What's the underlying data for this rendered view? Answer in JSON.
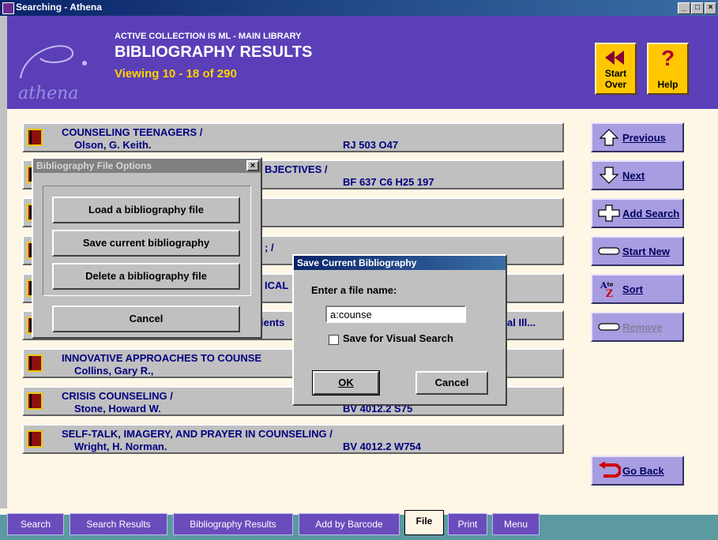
{
  "window": {
    "title": "Searching - Athena",
    "min": "_",
    "max": "□",
    "close": "×"
  },
  "header": {
    "collection": "ACTIVE COLLECTION IS ML - MAIN LIBRARY",
    "title": "BIBLIOGRAPHY RESULTS",
    "viewing": "Viewing 10 - 18 of 290",
    "logo": "athena",
    "start_over": "Start Over",
    "help": "Help"
  },
  "results": [
    {
      "title": "COUNSELING TEENAGERS /",
      "author": "Olson, G. Keith.",
      "call": "RJ 503 O47"
    },
    {
      "title": "BJECTIVES /",
      "author": "",
      "call": "BF 637 C6 H25 197"
    },
    {
      "title": "",
      "author": "",
      "call": ""
    },
    {
      "title": "; /",
      "author": "",
      "call": ""
    },
    {
      "title": "ICAL",
      "author": "",
      "call": ""
    },
    {
      "title": "ients",
      "author": "",
      "call": "al Ill..."
    },
    {
      "title": "INNOVATIVE APPROACHES TO COUNSE",
      "author": "Collins, Gary R.,",
      "call": ""
    },
    {
      "title": "CRISIS COUNSELING /",
      "author": "Stone, Howard W.",
      "call": "BV 4012.2 S75"
    },
    {
      "title": "SELF-TALK, IMAGERY, AND PRAYER IN COUNSELING /",
      "author": "Wright, H. Norman.",
      "call": "BV 4012.2 W754"
    }
  ],
  "side": {
    "previous": "Previous",
    "next": "Next",
    "add_search": "Add Search",
    "start_new": "Start New",
    "sort": "Sort",
    "remove": "Remove",
    "go_back": "Go Back"
  },
  "file_options": {
    "caption": "Bibliography File Options",
    "close": "×",
    "load": "Load a bibliography file",
    "save": "Save current bibliography",
    "delete": "Delete a bibliography file",
    "cancel": "Cancel"
  },
  "save_dialog": {
    "caption": "Save Current Bibliography",
    "prompt": "Enter a file name:",
    "filename": "a:counse",
    "visual_label": "Save for Visual Search",
    "ok": "OK",
    "cancel": "Cancel"
  },
  "tabs": [
    "Search",
    "Search Results",
    "Bibliography Results",
    "Add by Barcode",
    "File",
    "Print",
    "Menu"
  ],
  "colors": {
    "header": "#5b3fb8",
    "accent_yellow": "#ffc800",
    "side_button": "#a89de0"
  }
}
